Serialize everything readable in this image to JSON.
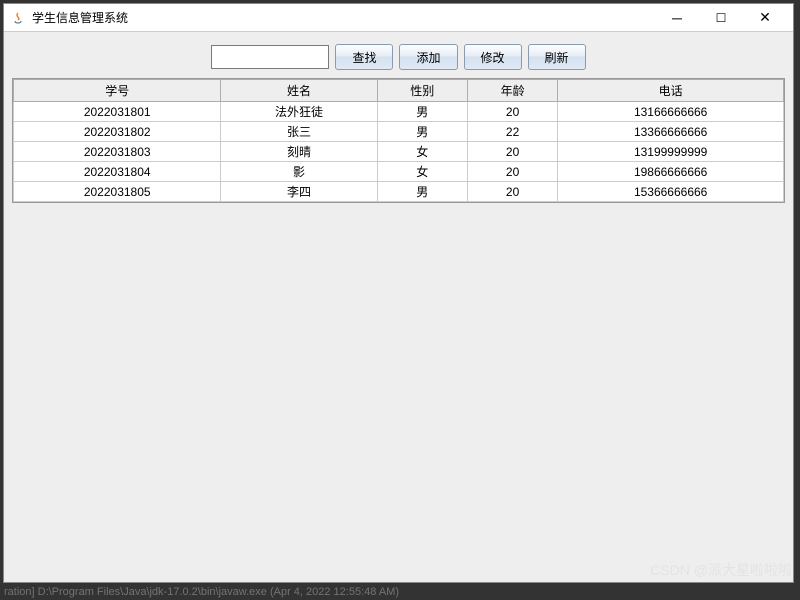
{
  "window": {
    "title": "学生信息管理系统"
  },
  "toolbar": {
    "search_value": "",
    "search_label": "查找",
    "add_label": "添加",
    "edit_label": "修改",
    "refresh_label": "刷新"
  },
  "table": {
    "headers": {
      "id": "学号",
      "name": "姓名",
      "gender": "性别",
      "age": "年龄",
      "phone": "电话"
    },
    "rows": [
      {
        "id": "2022031801",
        "name": "法外狂徒",
        "gender": "男",
        "age": "20",
        "phone": "13166666666"
      },
      {
        "id": "2022031802",
        "name": "张三",
        "gender": "男",
        "age": "22",
        "phone": "13366666666"
      },
      {
        "id": "2022031803",
        "name": "刻晴",
        "gender": "女",
        "age": "20",
        "phone": "13199999999"
      },
      {
        "id": "2022031804",
        "name": "影",
        "gender": "女",
        "age": "20",
        "phone": "19866666666"
      },
      {
        "id": "2022031805",
        "name": "李四",
        "gender": "男",
        "age": "20",
        "phone": "15366666666"
      }
    ]
  },
  "watermark": "CSDN @派大星啦啦啦",
  "footer": "ration] D:\\Program Files\\Java\\jdk-17.0.2\\bin\\javaw.exe  (Apr 4, 2022  12:55:48 AM)"
}
